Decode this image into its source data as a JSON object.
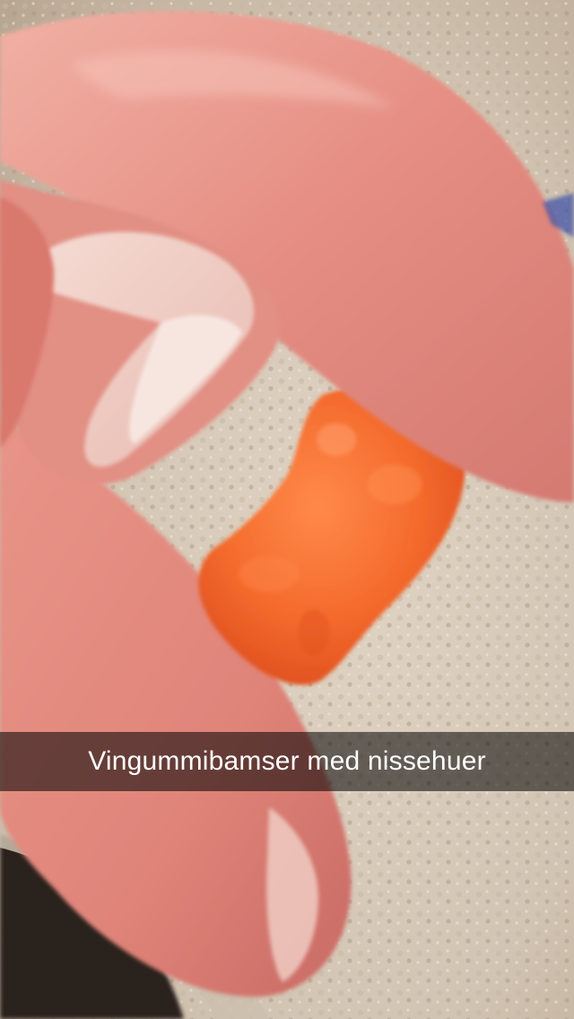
{
  "caption": {
    "text": "Vingummibamser med nissehuer"
  },
  "colors": {
    "carpet": "#d8cbbb",
    "carpet_shadow": "#b9a996",
    "skin": "#e99a8e",
    "skin_dark": "#c9706a",
    "nail": "#f3d9d0",
    "gummy_bear": "#f46a2c",
    "gummy_bear_dark": "#d9481c",
    "caption_bar": "#000000",
    "caption_text": "#ffffff"
  }
}
